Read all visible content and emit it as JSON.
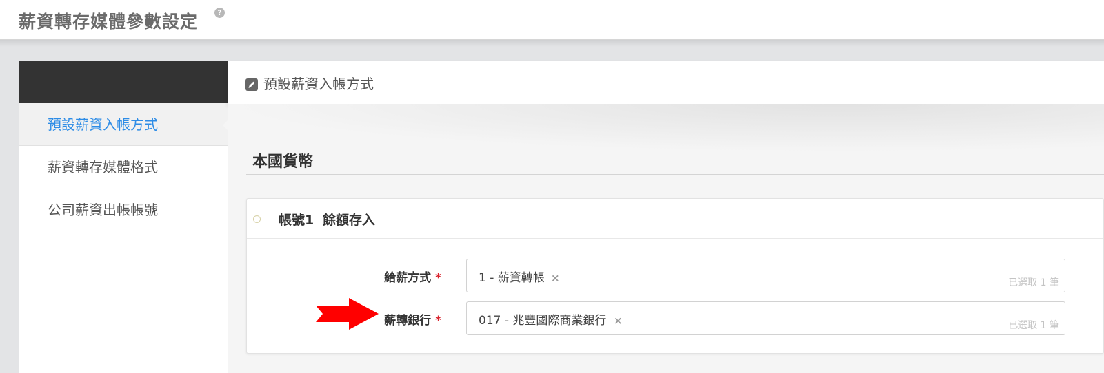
{
  "page": {
    "title": "薪資轉存媒體參數設定",
    "help_icon": "?"
  },
  "sidebar": {
    "items": [
      {
        "label": "預設薪資入帳方式",
        "active": true
      },
      {
        "label": "薪資轉存媒體格式",
        "active": false
      },
      {
        "label": "公司薪資出帳帳號",
        "active": false
      }
    ],
    "active_color": "#2d8ce6"
  },
  "panel": {
    "title": "預設薪資入帳方式",
    "icon": "edit-icon"
  },
  "section": {
    "title": "本國貨幣"
  },
  "account": {
    "number": "帳號1",
    "type": "餘額存入",
    "fields": [
      {
        "label": "給薪方式",
        "required_mark": "*",
        "value": "1 - 薪資轉帳",
        "remove": "×",
        "count_hint": "已選取 1 筆"
      },
      {
        "label": "薪轉銀行",
        "required_mark": "*",
        "value": "017 - 兆豐國際商業銀行",
        "remove": "×",
        "count_hint": "已選取 1 筆"
      }
    ]
  },
  "annotation": {
    "arrow_color": "#ff0000",
    "icon": "red-arrow-icon"
  }
}
